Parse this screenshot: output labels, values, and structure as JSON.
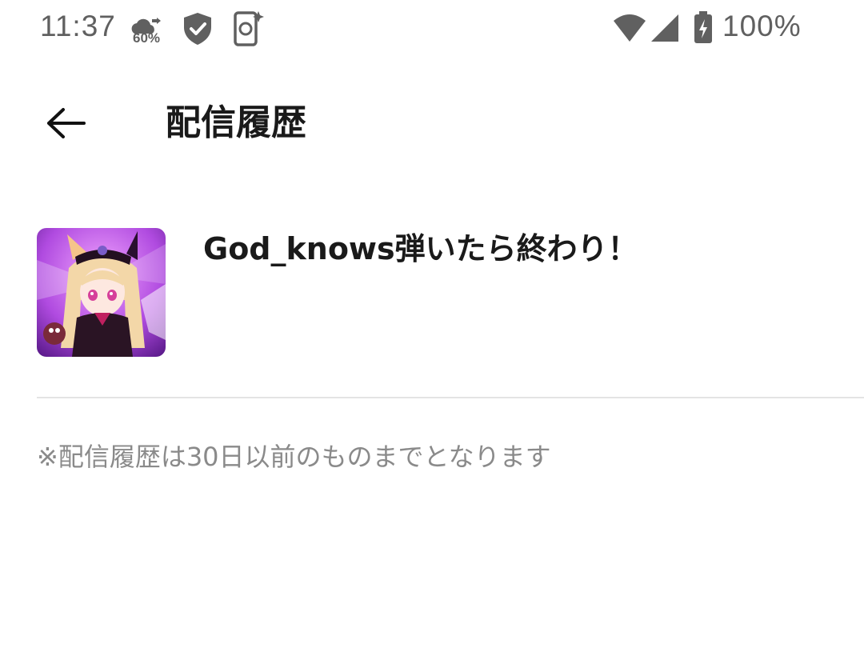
{
  "status_bar": {
    "time": "11:37",
    "weather_percent": "60%",
    "battery_percent": "100%"
  },
  "app_bar": {
    "title": "配信履歴"
  },
  "history": {
    "items": [
      {
        "title": "God_knows弾いたら終わり！",
        "subtitle": "",
        "thumbnail_icon": "anime-girl-avatar"
      }
    ]
  },
  "footer_note": "※配信履歴は30日以前のものまでとなります",
  "colors": {
    "background": "#ffffff",
    "text_primary": "#1a1a1a",
    "text_secondary": "#8a8a8a",
    "divider": "#e4e4e4",
    "status_icons": "#606060"
  }
}
